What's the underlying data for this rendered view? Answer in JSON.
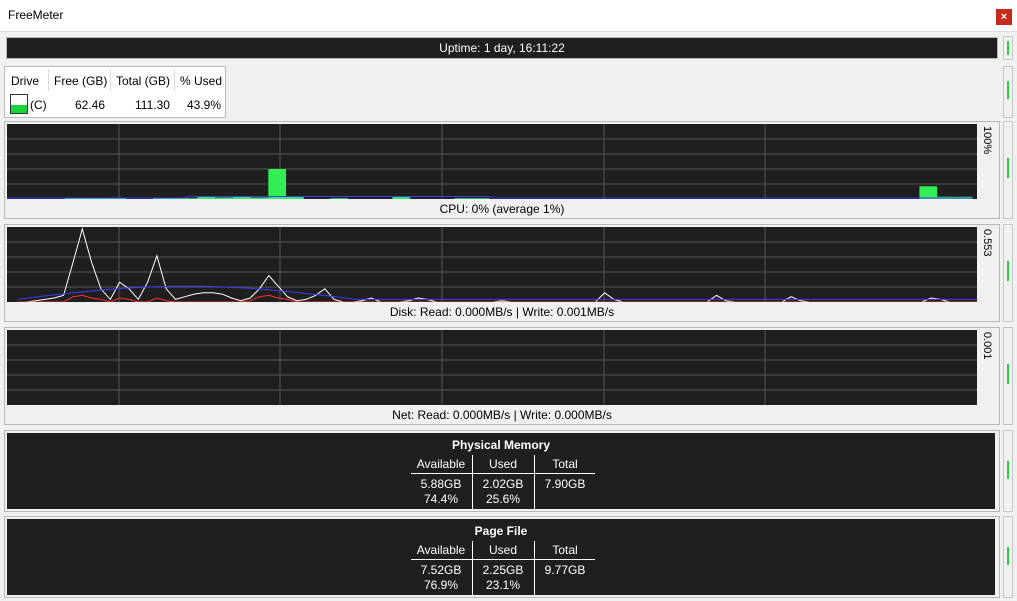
{
  "window": {
    "title": "FreeMeter",
    "close_label": "×"
  },
  "uptime": "Uptime: 1 day, 16:11:22",
  "drives": {
    "headers": [
      "Drive",
      "Free (GB)",
      "Total (GB)",
      "% Used"
    ],
    "rows": [
      {
        "drive": "(C)",
        "free": "62.46",
        "total": "111.30",
        "used": "43.9%"
      }
    ],
    "used_fraction": 0.439
  },
  "cpu": {
    "label": "CPU: 0% (average 1%)",
    "scale": "100%",
    "colors": {
      "bars": "#33ee55",
      "average": "#3b3bff",
      "grid": "#555555"
    }
  },
  "disk": {
    "label": "Disk:  Read: 0.000MB/s  |  Write: 0.001MB/s",
    "scale": "0.553",
    "colors": {
      "total": "#ffffff",
      "read": "#ff3030",
      "average": "#3b3bff"
    }
  },
  "net": {
    "label": "Net:  Read: 0.000MB/s  |  Write: 0.000MB/s",
    "scale": "0.001"
  },
  "physical_memory": {
    "title": "Physical Memory",
    "headers": [
      "Available",
      "Used",
      "Total"
    ],
    "available": [
      "5.88GB",
      "74.4%"
    ],
    "used": [
      "2.02GB",
      "25.6%"
    ],
    "total": [
      "7.90GB"
    ]
  },
  "page_file": {
    "title": "Page File",
    "headers": [
      "Available",
      "Used",
      "Total"
    ],
    "available": [
      "7.52GB",
      "76.9%"
    ],
    "used": [
      "2.25GB",
      "23.1%"
    ],
    "total": [
      "9.77GB"
    ]
  },
  "chart_data": [
    {
      "type": "bar",
      "title": "CPU",
      "ylim": [
        0,
        100
      ],
      "series": [
        {
          "values": [
            0,
            0,
            0,
            0,
            0,
            0,
            0,
            0,
            0,
            0,
            0,
            0,
            0,
            1,
            0,
            0,
            0,
            1,
            0,
            1,
            0,
            0,
            0,
            1,
            0,
            0,
            0,
            0,
            0,
            0,
            0,
            0,
            0,
            2,
            0,
            0,
            0,
            1,
            0,
            1,
            0,
            0,
            0,
            3,
            0,
            0,
            0,
            2,
            0,
            0,
            0,
            4,
            0,
            0,
            0,
            2,
            0,
            0,
            0,
            40,
            0,
            0,
            0,
            3,
            0,
            0,
            0,
            0,
            0,
            0,
            0,
            0,
            0,
            1,
            0,
            0,
            0,
            0,
            0,
            0,
            0,
            0,
            0,
            0,
            0,
            0,
            0,
            4,
            0,
            0,
            0,
            0,
            0,
            0,
            0,
            0,
            0,
            0,
            0,
            0,
            0,
            1,
            0,
            0,
            0,
            1,
            0,
            0,
            0,
            0,
            0,
            0,
            0,
            0,
            0,
            0,
            0,
            0,
            0,
            0,
            0,
            0,
            0,
            0,
            0,
            0,
            0,
            0,
            0,
            0,
            0,
            0,
            0,
            0,
            0,
            0,
            0,
            0,
            0,
            0,
            0,
            0,
            0,
            0,
            0,
            0,
            0,
            0,
            0,
            0,
            0,
            0,
            0,
            0,
            0,
            0,
            0,
            0,
            0,
            0,
            0,
            0,
            0,
            0,
            0,
            0,
            0,
            0,
            0,
            0,
            0,
            0,
            0,
            0,
            0,
            0,
            0,
            0,
            0,
            0,
            0,
            0,
            0,
            0,
            0,
            0,
            0,
            0,
            0,
            0,
            0,
            0,
            0,
            0,
            0,
            0,
            0,
            0,
            0,
            0,
            0,
            0,
            0,
            0,
            0,
            0,
            17,
            0,
            0,
            0,
            3,
            0,
            0,
            0,
            3,
            0,
            0,
            0,
            0
          ]
        }
      ]
    },
    {
      "type": "line",
      "title": "Disk",
      "ylim": [
        0,
        0.553
      ],
      "series": [
        {
          "values": [
            0,
            0,
            0.01,
            0.02,
            0.03,
            0.05,
            0.3,
            0.553,
            0.3,
            0.1,
            0.02,
            0.15,
            0.1,
            0.02,
            0.15,
            0.35,
            0.1,
            0.02,
            0.04,
            0.06,
            0.07,
            0.07,
            0.06,
            0.03,
            0.01,
            0.03,
            0.1,
            0.2,
            0.12,
            0.04,
            0.01,
            0.02,
            0.05,
            0.1,
            0.02,
            0,
            0,
            0.01,
            0.03,
            0,
            0,
            0,
            0.01,
            0.03,
            0.02,
            0,
            0,
            0,
            0,
            0,
            0,
            0,
            0.01,
            0,
            0,
            0,
            0,
            0,
            0,
            0,
            0,
            0,
            0,
            0.07,
            0.02,
            0,
            0,
            0,
            0,
            0,
            0,
            0,
            0,
            0,
            0,
            0.05,
            0.01,
            0,
            0,
            0,
            0,
            0,
            0,
            0.04,
            0.01,
            0,
            0,
            0,
            0,
            0,
            0,
            0,
            0,
            0,
            0,
            0,
            0,
            0,
            0.03,
            0.02,
            0,
            0,
            0,
            0
          ]
        },
        {
          "values": [
            0,
            0,
            0,
            0,
            0,
            0,
            0.04,
            0.05,
            0.03,
            0.02,
            0,
            0.03,
            0.02,
            0,
            0,
            0.03,
            0.01,
            0,
            0,
            0,
            0,
            0,
            0,
            0,
            0,
            0.01,
            0.04,
            0.05,
            0.03,
            0.02,
            0,
            0,
            0,
            0,
            0,
            0,
            0,
            0,
            0,
            0,
            0,
            0,
            0,
            0,
            0,
            0,
            0,
            0,
            0,
            0,
            0,
            0,
            0,
            0,
            0,
            0,
            0,
            0,
            0,
            0,
            0,
            0,
            0,
            0,
            0,
            0,
            0,
            0,
            0,
            0,
            0,
            0,
            0,
            0,
            0,
            0,
            0,
            0,
            0,
            0,
            0,
            0,
            0,
            0,
            0,
            0,
            0,
            0,
            0,
            0,
            0,
            0,
            0,
            0,
            0,
            0,
            0,
            0,
            0,
            0,
            0,
            0,
            0,
            0
          ]
        }
      ]
    }
  ]
}
